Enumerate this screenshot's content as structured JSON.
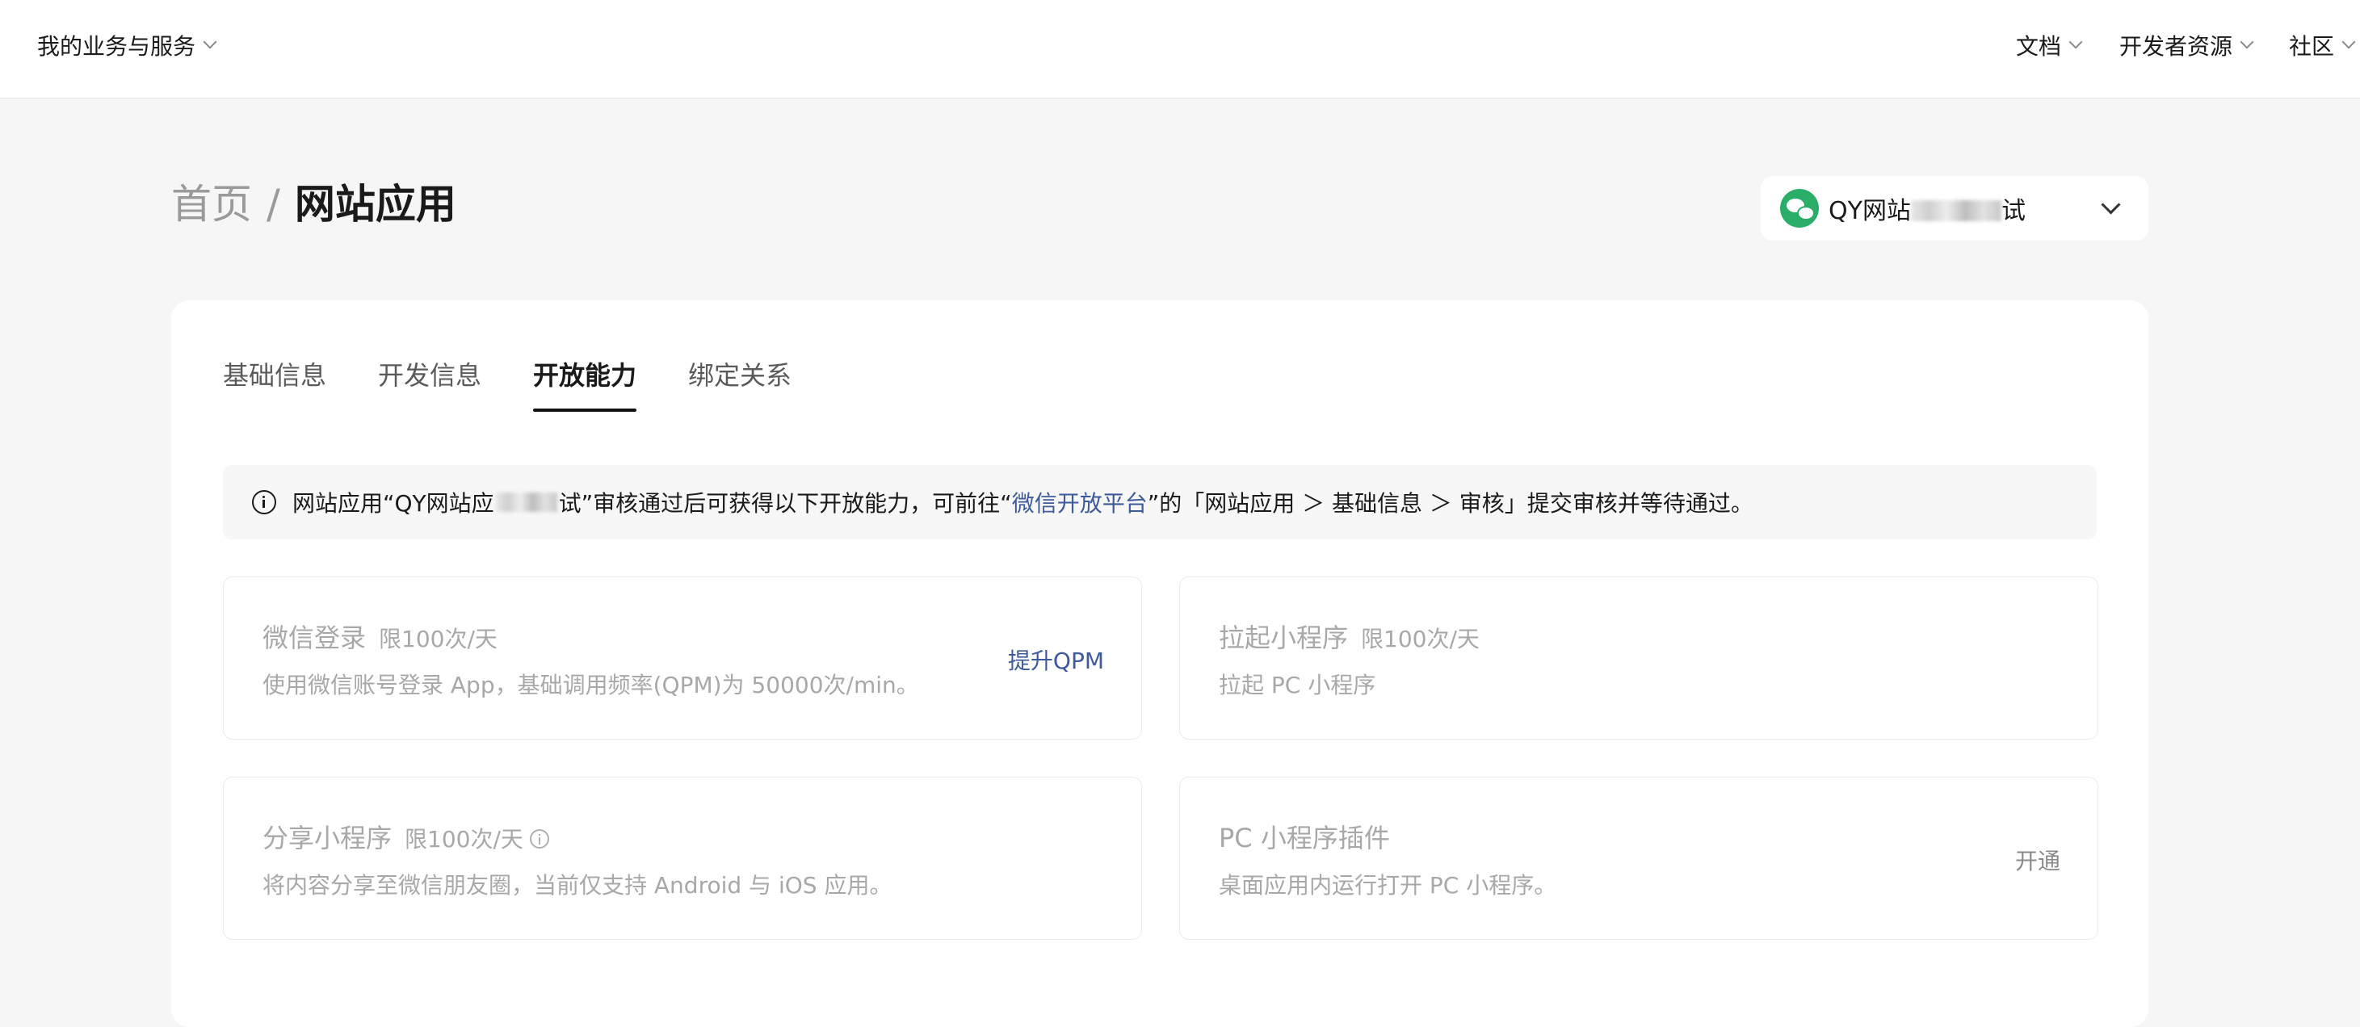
{
  "topbar": {
    "services_label": "我的业务与服务",
    "nav": [
      "文档",
      "开发者资源",
      "社区"
    ]
  },
  "breadcrumb": {
    "home": "首页",
    "separator": "/",
    "current": "网站应用"
  },
  "app_selector": {
    "name_visible": "QY网站",
    "name_suffix": "试"
  },
  "tabs": [
    {
      "label": "基础信息",
      "active": false
    },
    {
      "label": "开发信息",
      "active": false
    },
    {
      "label": "开放能力",
      "active": true
    },
    {
      "label": "绑定关系",
      "active": false
    }
  ],
  "notice": {
    "prefix": "网站应用“QY网站应",
    "middle": "”审核通过后可获得以下开放能力，可前往“",
    "link": "微信开放平台",
    "suffix": "”的「网站应用 ＞ 基础信息 ＞ 审核」提交审核并等待通过。",
    "middle_pre": "试"
  },
  "features": [
    {
      "title": "微信登录",
      "limit": "限100次/天",
      "desc": "使用微信账号登录 App，基础调用频率(QPM)为 50000次/min。",
      "action": "提升QPM"
    },
    {
      "title": "拉起小程序",
      "limit": "限100次/天",
      "desc": "拉起 PC 小程序",
      "action": ""
    },
    {
      "title": "分享小程序",
      "limit": "限100次/天",
      "desc": "将内容分享至微信朋友圈，当前仅支持 Android 与 iOS 应用。",
      "action": ""
    },
    {
      "title": "PC 小程序插件",
      "limit": "",
      "desc": "桌面应用内运行打开 PC 小程序。",
      "action": "开通"
    }
  ],
  "colors": {
    "link": "#3d5a9c",
    "wechat_green": "#2aae67",
    "page_bg": "#f6f6f6"
  }
}
